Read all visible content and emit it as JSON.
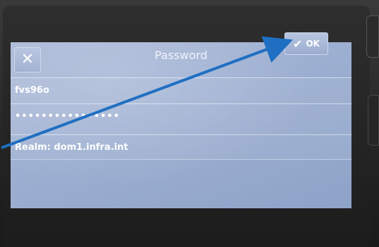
{
  "dialog": {
    "title": "Password",
    "close_label": "✕",
    "ok_label": "OK",
    "ok_check": "✔"
  },
  "fields": {
    "username": "fvs96o",
    "password": "••••••••••••••••",
    "realm": "Realm: dom1.infra.int"
  },
  "colors": {
    "screen": "#9eb0d2",
    "annotation_arrow": "#1f6fc2",
    "bezel": "#1c1c1c"
  },
  "icons": {
    "close": "close-icon",
    "ok": "check-icon"
  }
}
